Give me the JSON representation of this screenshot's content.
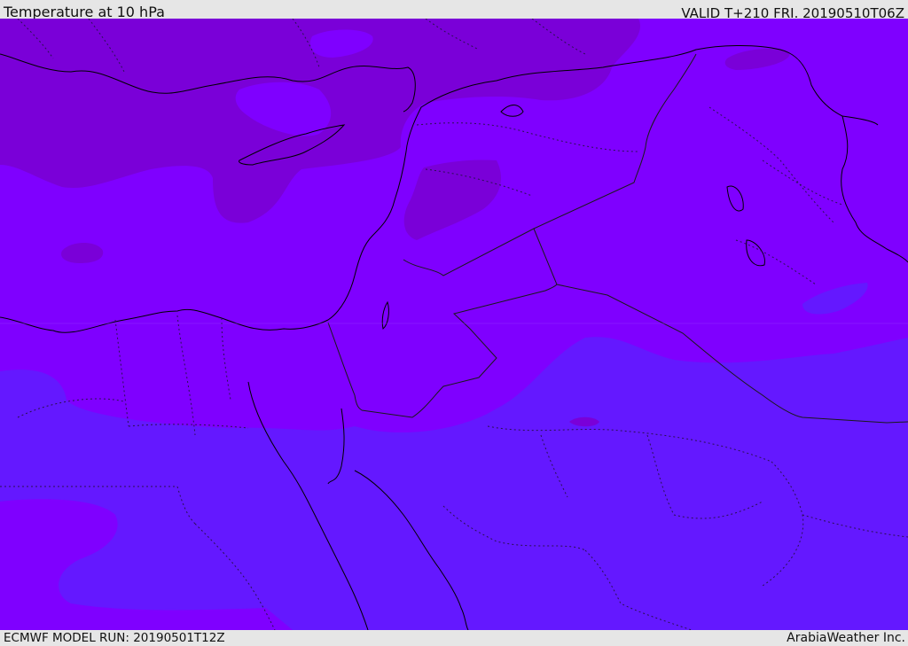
{
  "header": {
    "title": "Temperature at 10 hPa",
    "valid_time": "VALID T+210 FRI. 20190510T06Z"
  },
  "footer": {
    "model_run": "ECMWF MODEL RUN: 20190501T12Z",
    "brand": "ArabiaWeather Inc."
  },
  "map": {
    "field": "temperature",
    "level": "10 hPa",
    "palette": {
      "coldest_band": "#7A00D8",
      "mid_band": "#7F00FF",
      "warm_band": "#6418FF",
      "coast_color": "#000000",
      "border_color": "#1a1a1a"
    }
  }
}
